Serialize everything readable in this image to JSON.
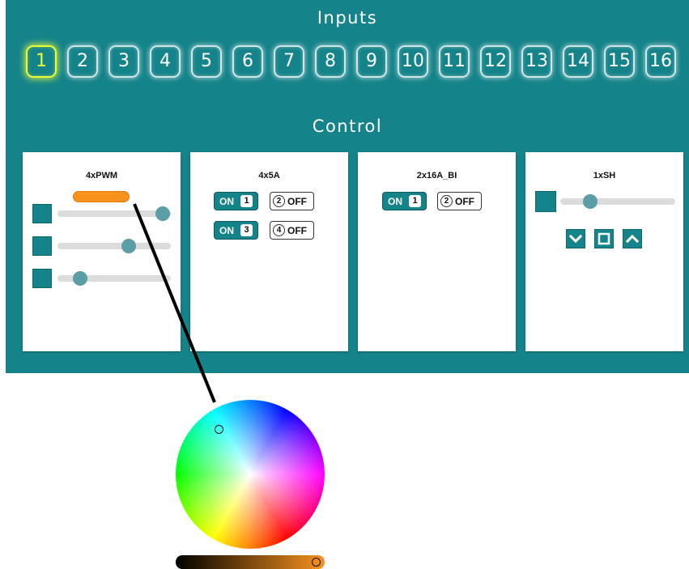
{
  "inputs": {
    "title": "Inputs",
    "buttons": [
      "1",
      "2",
      "3",
      "4",
      "5",
      "6",
      "7",
      "8",
      "9",
      "10",
      "11",
      "12",
      "13",
      "14",
      "15",
      "16"
    ],
    "active_index": 0
  },
  "control": {
    "title": "Control",
    "cards": [
      {
        "title": "4xPWM",
        "color": "#f7921e",
        "slider_levels": [
          0.93,
          0.63,
          0.2
        ]
      },
      {
        "title": "4x5A",
        "rows": [
          {
            "on_label": "ON",
            "on_num": "1",
            "off_label": "OFF",
            "off_num": "2"
          },
          {
            "on_label": "ON",
            "on_num": "3",
            "off_label": "OFF",
            "off_num": "4"
          }
        ]
      },
      {
        "title": "2x16A_BI",
        "rows": [
          {
            "on_label": "ON",
            "on_num": "1",
            "off_label": "OFF",
            "off_num": "2"
          }
        ]
      },
      {
        "title": "1xSH",
        "slider_level": 0.26,
        "buttons": [
          "chevron-down-icon",
          "stop-square-icon",
          "chevron-up-icon"
        ]
      }
    ]
  },
  "colors": {
    "teal": "#15848a",
    "accent_orange": "#f7921e",
    "active_glow": "#e8ff3a"
  }
}
